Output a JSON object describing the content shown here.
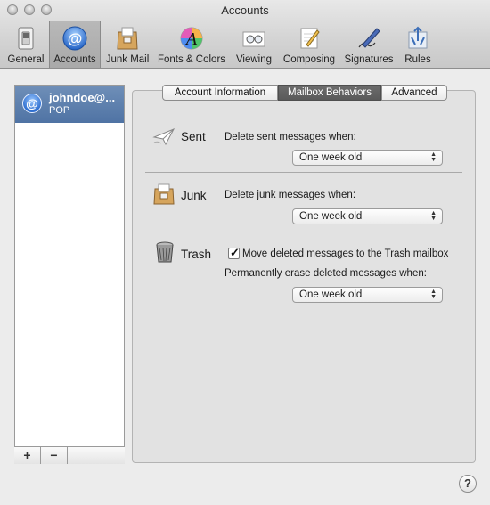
{
  "window": {
    "title": "Accounts"
  },
  "toolbar": {
    "items": [
      {
        "label": "General",
        "icon": "switch-icon"
      },
      {
        "label": "Accounts",
        "icon": "at-sign-icon"
      },
      {
        "label": "Junk Mail",
        "icon": "junk-bag-icon"
      },
      {
        "label": "Fonts & Colors",
        "icon": "fonts-colors-icon"
      },
      {
        "label": "Viewing",
        "icon": "viewing-glasses-icon"
      },
      {
        "label": "Composing",
        "icon": "pencil-paper-icon"
      },
      {
        "label": "Signatures",
        "icon": "signature-pen-icon"
      },
      {
        "label": "Rules",
        "icon": "rules-arrows-icon"
      }
    ],
    "selected": "Accounts"
  },
  "accounts": {
    "items": [
      {
        "name": "johndoe@...",
        "type": "POP"
      }
    ],
    "add_label": "+",
    "remove_label": "−"
  },
  "tabs": {
    "items": [
      "Account Information",
      "Mailbox Behaviors",
      "Advanced"
    ],
    "selected": "Mailbox Behaviors"
  },
  "sections": {
    "sent": {
      "title": "Sent",
      "label": "Delete sent messages when:",
      "value": "One week old"
    },
    "junk": {
      "title": "Junk",
      "label": "Delete junk messages when:",
      "value": "One week old"
    },
    "trash": {
      "title": "Trash",
      "checkbox_label": "Move deleted messages to the Trash mailbox",
      "checked": true,
      "label": "Permanently erase deleted messages when:",
      "value": "One week old"
    }
  },
  "help": {
    "label": "?"
  }
}
